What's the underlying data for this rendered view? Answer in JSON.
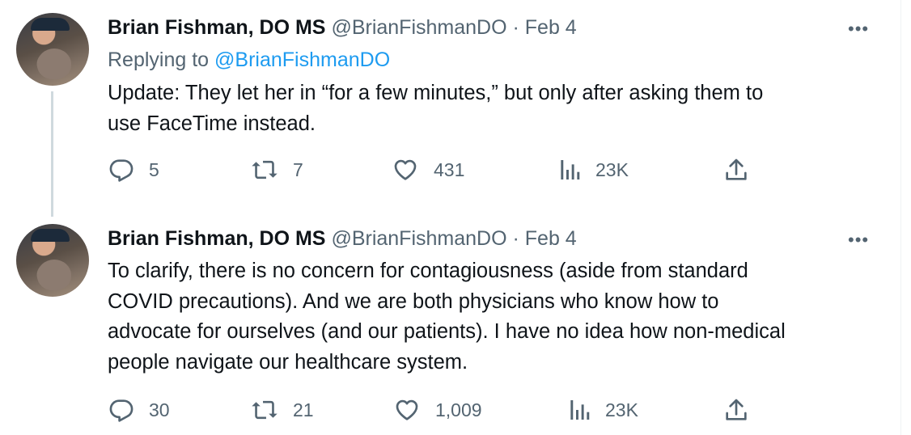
{
  "tweets": [
    {
      "author_name": "Brian Fishman, DO MS",
      "handle": "@BrianFishmanDO",
      "separator": "·",
      "date": "Feb 4",
      "more_label": "•••",
      "replying_prefix": "Replying to ",
      "replying_to": "@BrianFishmanDO",
      "text_lines": [
        "Update: They let her in “for a few minutes,” but only after asking them to",
        "use FaceTime instead."
      ],
      "actions": {
        "replies": "5",
        "retweets": "7",
        "likes": "431",
        "views": "23K"
      }
    },
    {
      "author_name": "Brian Fishman, DO MS",
      "handle": "@BrianFishmanDO",
      "separator": "·",
      "date": "Feb 4",
      "more_label": "•••",
      "text_lines": [
        "To clarify, there is no concern for contagiousness (aside from standard",
        "COVID precautions). And we are both physicians who know how to",
        "advocate for ourselves (and our patients). I have no idea how non-medical",
        "people navigate our healthcare system."
      ],
      "actions": {
        "replies": "30",
        "retweets": "21",
        "likes": "1,009",
        "views": "23K"
      }
    }
  ],
  "colors": {
    "text_primary": "#0f1419",
    "text_secondary": "#536471",
    "link": "#1d9bf0",
    "thread_line": "#cfd9de"
  },
  "icons": [
    "reply-icon",
    "retweet-icon",
    "like-icon",
    "views-icon",
    "share-icon",
    "more-icon"
  ]
}
